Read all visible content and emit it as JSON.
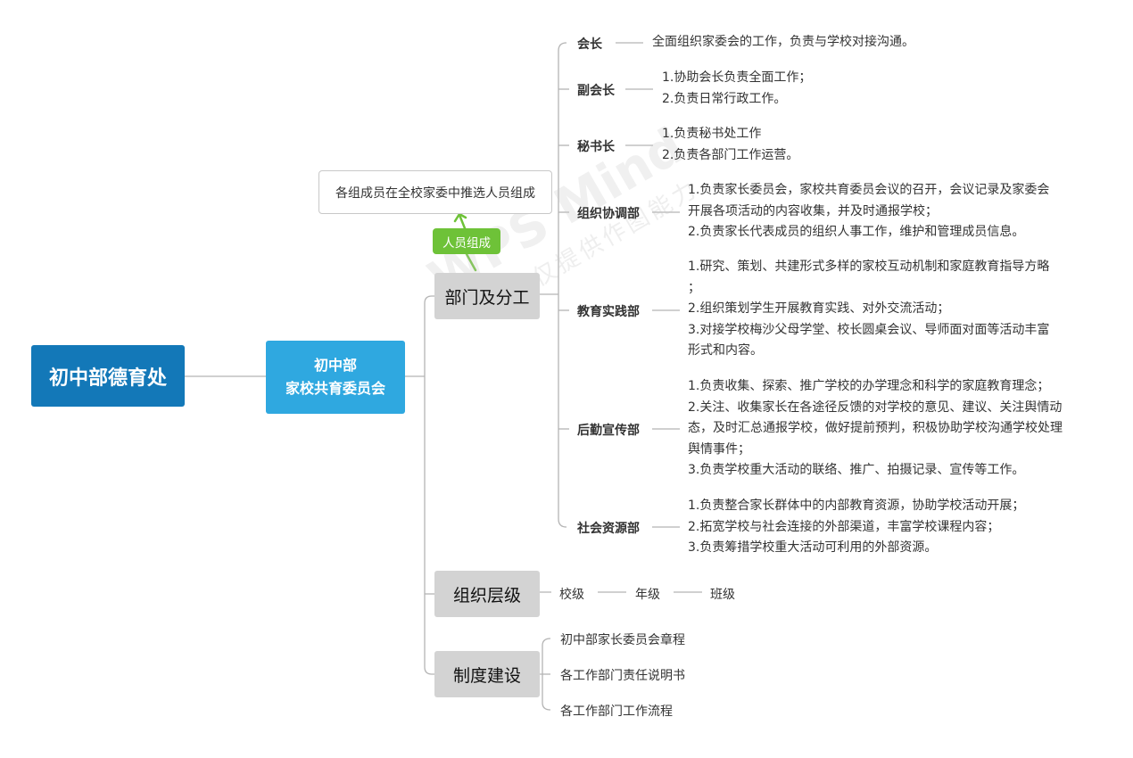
{
  "colors": {
    "root": "#1378b8",
    "level1": "#2fa8e0",
    "level2": "#d3d3d3",
    "tag": "#6ec238",
    "line": "#b4b4b4"
  },
  "root": {
    "label": "初中部德育处"
  },
  "committee": {
    "line1": "初中部",
    "line2": "家校共育委员会"
  },
  "branches": {
    "departments": {
      "label": "部门及分工",
      "tag": "人员组成",
      "callout": "各组成员在全校家委中推选人员组成",
      "roles": [
        {
          "name": "会长",
          "desc": [
            "全面组织家委会的工作，负责与学校对接沟通。"
          ]
        },
        {
          "name": "副会长",
          "desc": [
            "1.协助会长负责全面工作；",
            "2.负责日常行政工作。"
          ]
        },
        {
          "name": "秘书长",
          "desc": [
            "1.负责秘书处工作",
            "2.负责各部门工作运营。"
          ]
        },
        {
          "name": "组织协调部",
          "desc": [
            "1.负责家长委员会，家校共育委员会议的召开，会议记录及家委会",
            "开展各项活动的内容收集，并及时通报学校；",
            "2.负责家长代表成员的组织人事工作，维护和管理成员信息。"
          ]
        },
        {
          "name": "教育实践部",
          "desc": [
            "1.研究、策划、共建形式多样的家校互动机制和家庭教育指导方略",
            "；",
            "2.组织策划学生开展教育实践、对外交流活动；",
            "3.对接学校梅沙父母学堂、校长圆桌会议、导师面对面等活动丰富",
            "形式和内容。"
          ]
        },
        {
          "name": "后勤宣传部",
          "desc": [
            "1.负责收集、探索、推广学校的办学理念和科学的家庭教育理念；",
            "2.关注、收集家长在各途径反馈的对学校的意见、建议、关注舆情动",
            "态，及时汇总通报学校，做好提前预判，积极协助学校沟通学校处理",
            "舆情事件；",
            "3.负责学校重大活动的联络、推广、拍摄记录、宣传等工作。"
          ]
        },
        {
          "name": "社会资源部",
          "desc": [
            "1.负责整合家长群体中的内部教育资源，协助学校活动开展；",
            "2.拓宽学校与社会连接的外部渠道，丰富学校课程内容；",
            "3.负责筹措学校重大活动可利用的外部资源。"
          ]
        }
      ]
    },
    "levels": {
      "label": "组织层级",
      "items": [
        "校级",
        "年级",
        "班级"
      ]
    },
    "system": {
      "label": "制度建设",
      "items": [
        "初中部家长委员会章程",
        "各工作部门责任说明书",
        "各工作部门工作流程"
      ]
    }
  },
  "watermark": {
    "brand": "WPS Mind",
    "notice": "WPS仅提供作图能力"
  }
}
